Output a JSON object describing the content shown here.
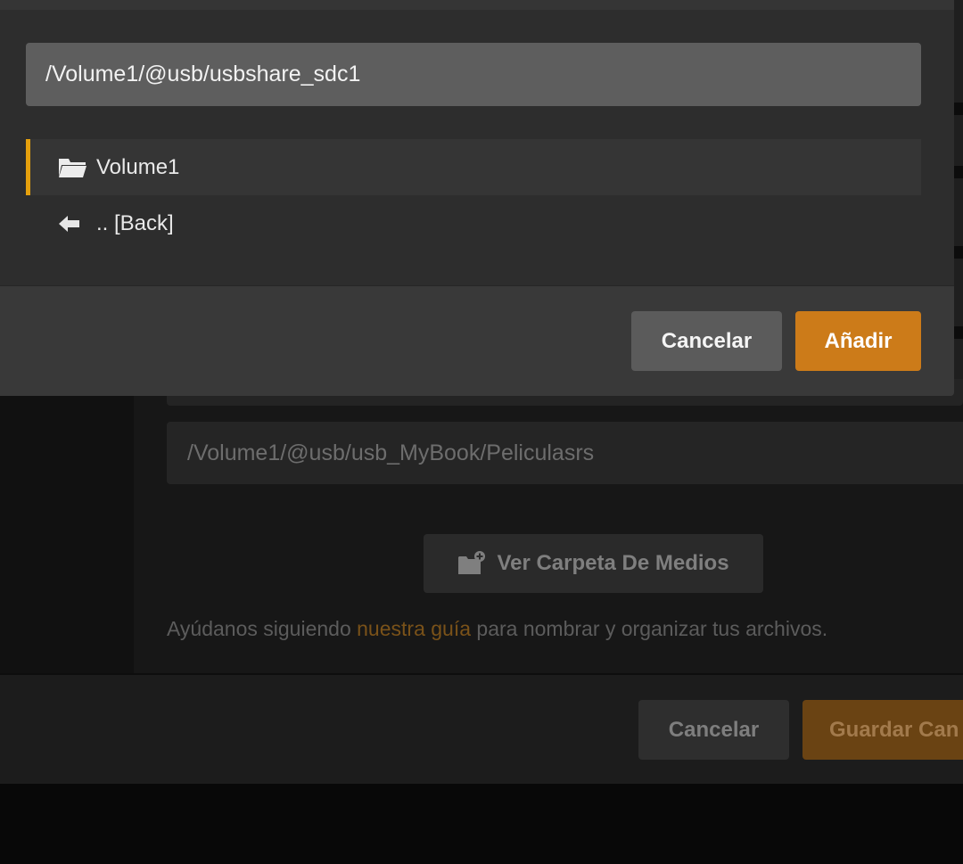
{
  "dialog": {
    "path_value": "/Volume1/@usb/usbshare_sdc1",
    "items": [
      {
        "label": "Volume1",
        "icon": "folder-open-icon",
        "selected": true
      },
      {
        "label": ".. [Back]",
        "icon": "arrow-left-icon",
        "selected": false
      }
    ],
    "cancel_label": "Cancelar",
    "add_label": "Añadir"
  },
  "background": {
    "folder_path_value": "/Volume1/@usb/usb_MyBook/Peliculasrs",
    "browse_button_label": "Ver Carpeta De Medios",
    "browse_icon": "folder-add-icon",
    "help_prefix": "Ayúdanos siguiendo ",
    "help_link": "nuestra guía",
    "help_suffix": " para nombrar y organizar tus archivos.",
    "cancel_label": "Cancelar",
    "save_label": "Guardar Can"
  },
  "colors": {
    "accent": "#e5a00d",
    "primary_button": "#cc7b19",
    "dialog_bg": "#2d2d2d"
  }
}
